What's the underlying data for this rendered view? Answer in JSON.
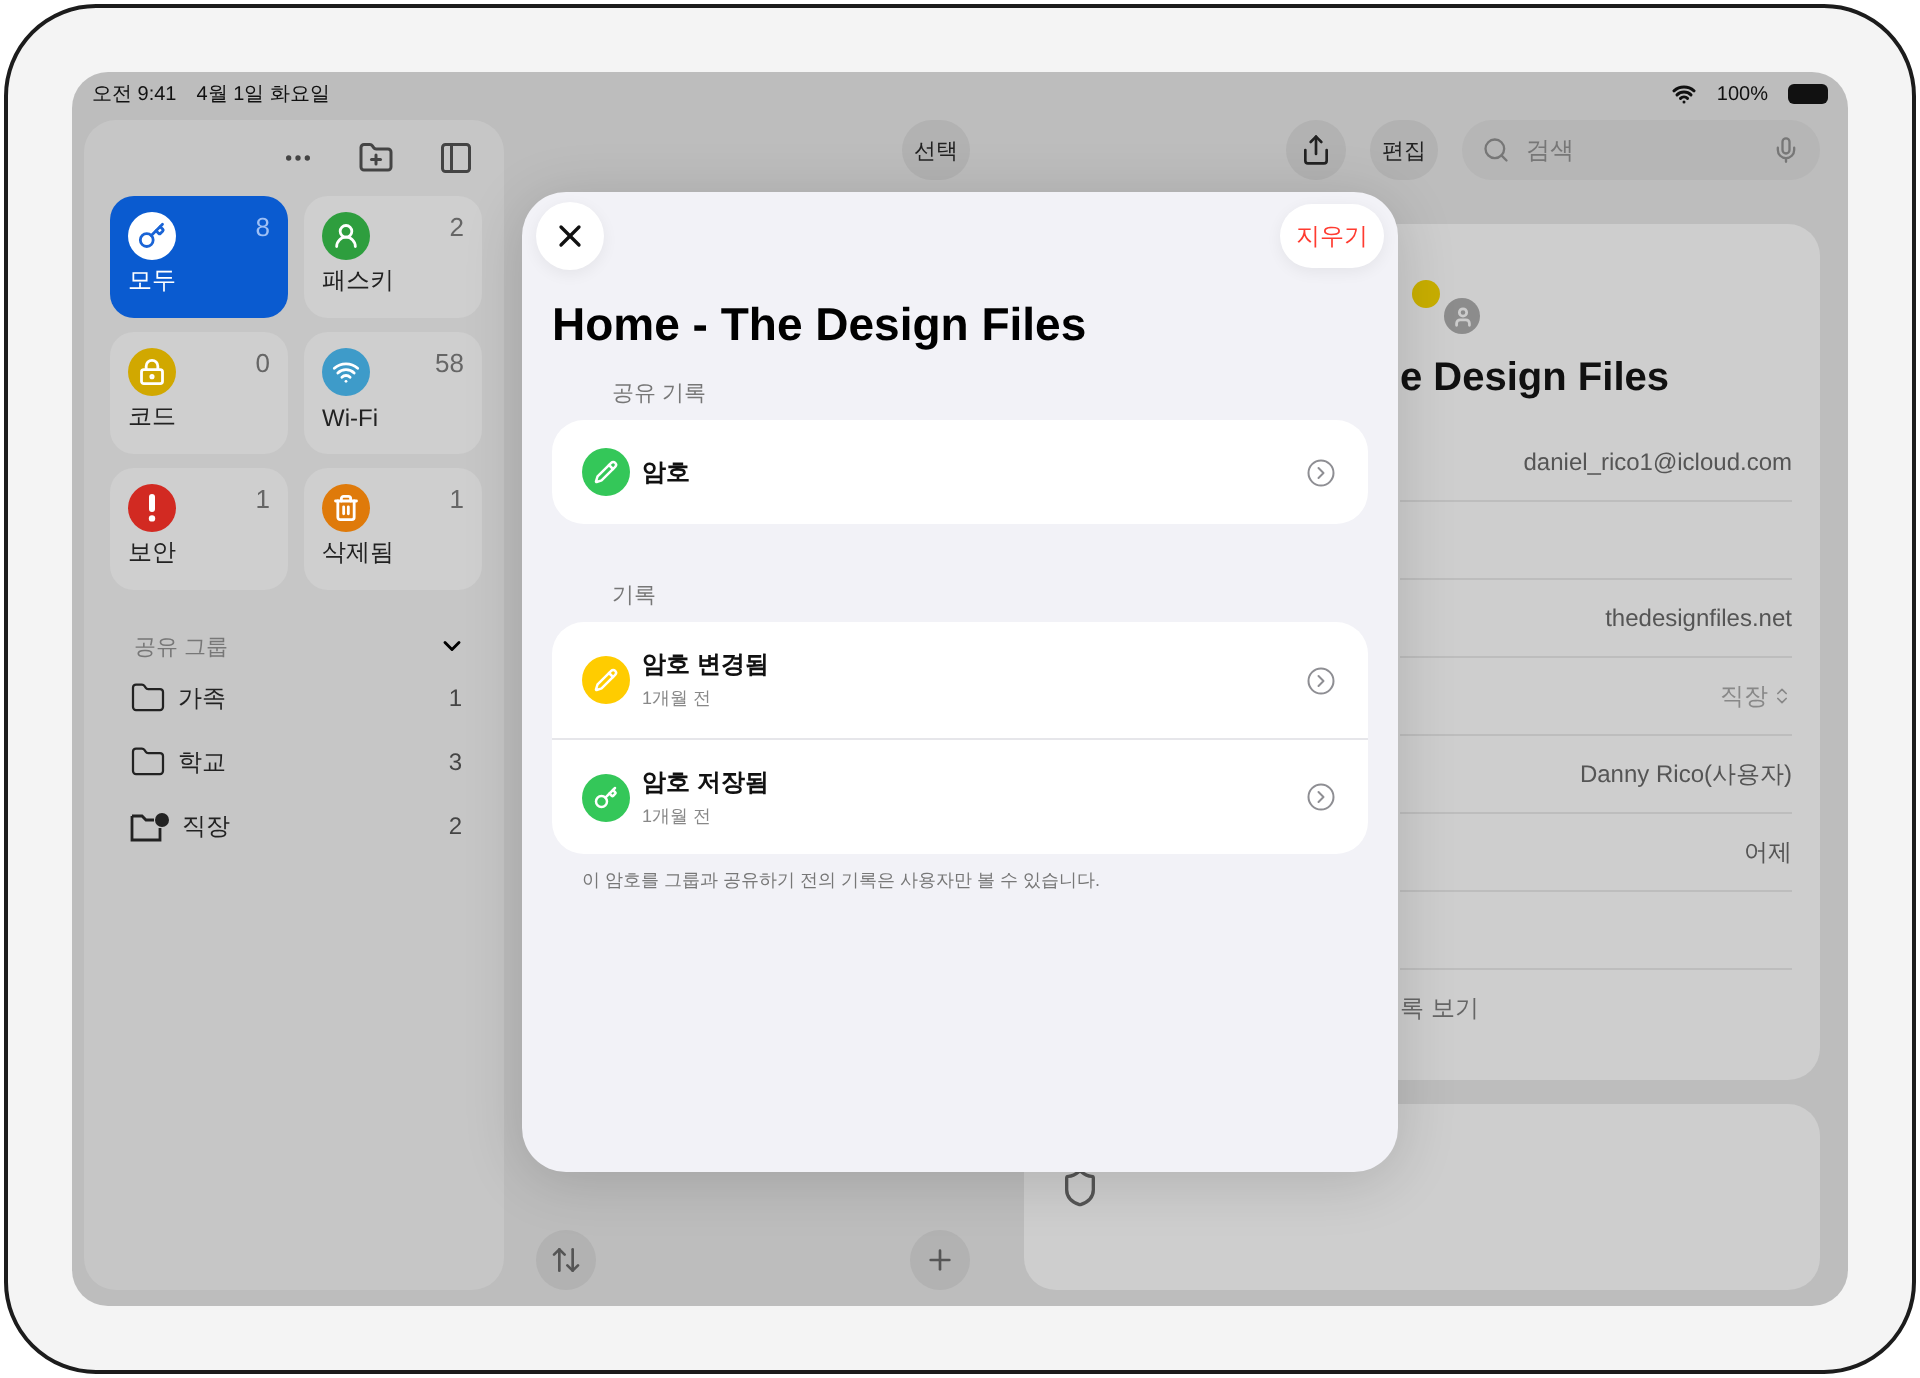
{
  "status_bar": {
    "time": "오전 9:41",
    "date": "4월 1일 화요일",
    "battery": "100%"
  },
  "sidebar": {
    "categories": [
      {
        "label": "모두",
        "count": "8",
        "kind": "key",
        "color": "#1a64d6",
        "selected": true
      },
      {
        "label": "패스키",
        "count": "2",
        "kind": "passkey",
        "color": "#2e9e3e",
        "selected": false
      },
      {
        "label": "코드",
        "count": "0",
        "kind": "lock",
        "color": "#d1a800",
        "selected": false
      },
      {
        "label": "Wi-Fi",
        "count": "58",
        "kind": "wifi",
        "color": "#3e9bc9",
        "selected": false
      },
      {
        "label": "보안",
        "count": "1",
        "kind": "alert",
        "color": "#d22a22",
        "selected": false
      },
      {
        "label": "삭제됨",
        "count": "1",
        "kind": "trash",
        "color": "#df7a0a",
        "selected": false
      }
    ],
    "section": {
      "title": "공유 그룹",
      "expanded": true,
      "groups": [
        {
          "label": "가족",
          "count": "1",
          "kind": "folder"
        },
        {
          "label": "학교",
          "count": "3",
          "kind": "folder"
        },
        {
          "label": "직장",
          "count": "2",
          "kind": "shared"
        }
      ]
    }
  },
  "list_toolbar": {
    "select_button": "선택"
  },
  "detail": {
    "edit_button": "편집",
    "search": {
      "placeholder": "검색"
    },
    "title": "e Design Files",
    "fields": [
      {
        "kind": "value",
        "value": "daniel_rico1@icloud.com"
      },
      {
        "kind": "blank"
      },
      {
        "kind": "value",
        "value": "thedesignfiles.net"
      },
      {
        "kind": "picker",
        "value": "직장"
      },
      {
        "kind": "value",
        "value": "Danny Rico(사용자)"
      },
      {
        "kind": "value",
        "value": "어제"
      },
      {
        "kind": "blank"
      },
      {
        "kind": "link",
        "value": "록 보기"
      }
    ]
  },
  "modal": {
    "clear_button": "지우기",
    "title": "Home - The Design Files",
    "sections": [
      {
        "header": "공유 기록",
        "items": [
          {
            "label": "암호",
            "kind": "pencil",
            "color": "#34c759"
          }
        ]
      },
      {
        "header": "기록",
        "items": [
          {
            "label": "암호 변경됨",
            "subtitle": "1개월 전",
            "kind": "pencil",
            "color": "#ffcc00"
          },
          {
            "label": "암호 저장됨",
            "subtitle": "1개월 전",
            "kind": "key",
            "color": "#34c759"
          }
        ],
        "footer": "이 암호를 그룹과 공유하기 전의 기록은 사용자만 볼 수 있습니다."
      }
    ]
  }
}
